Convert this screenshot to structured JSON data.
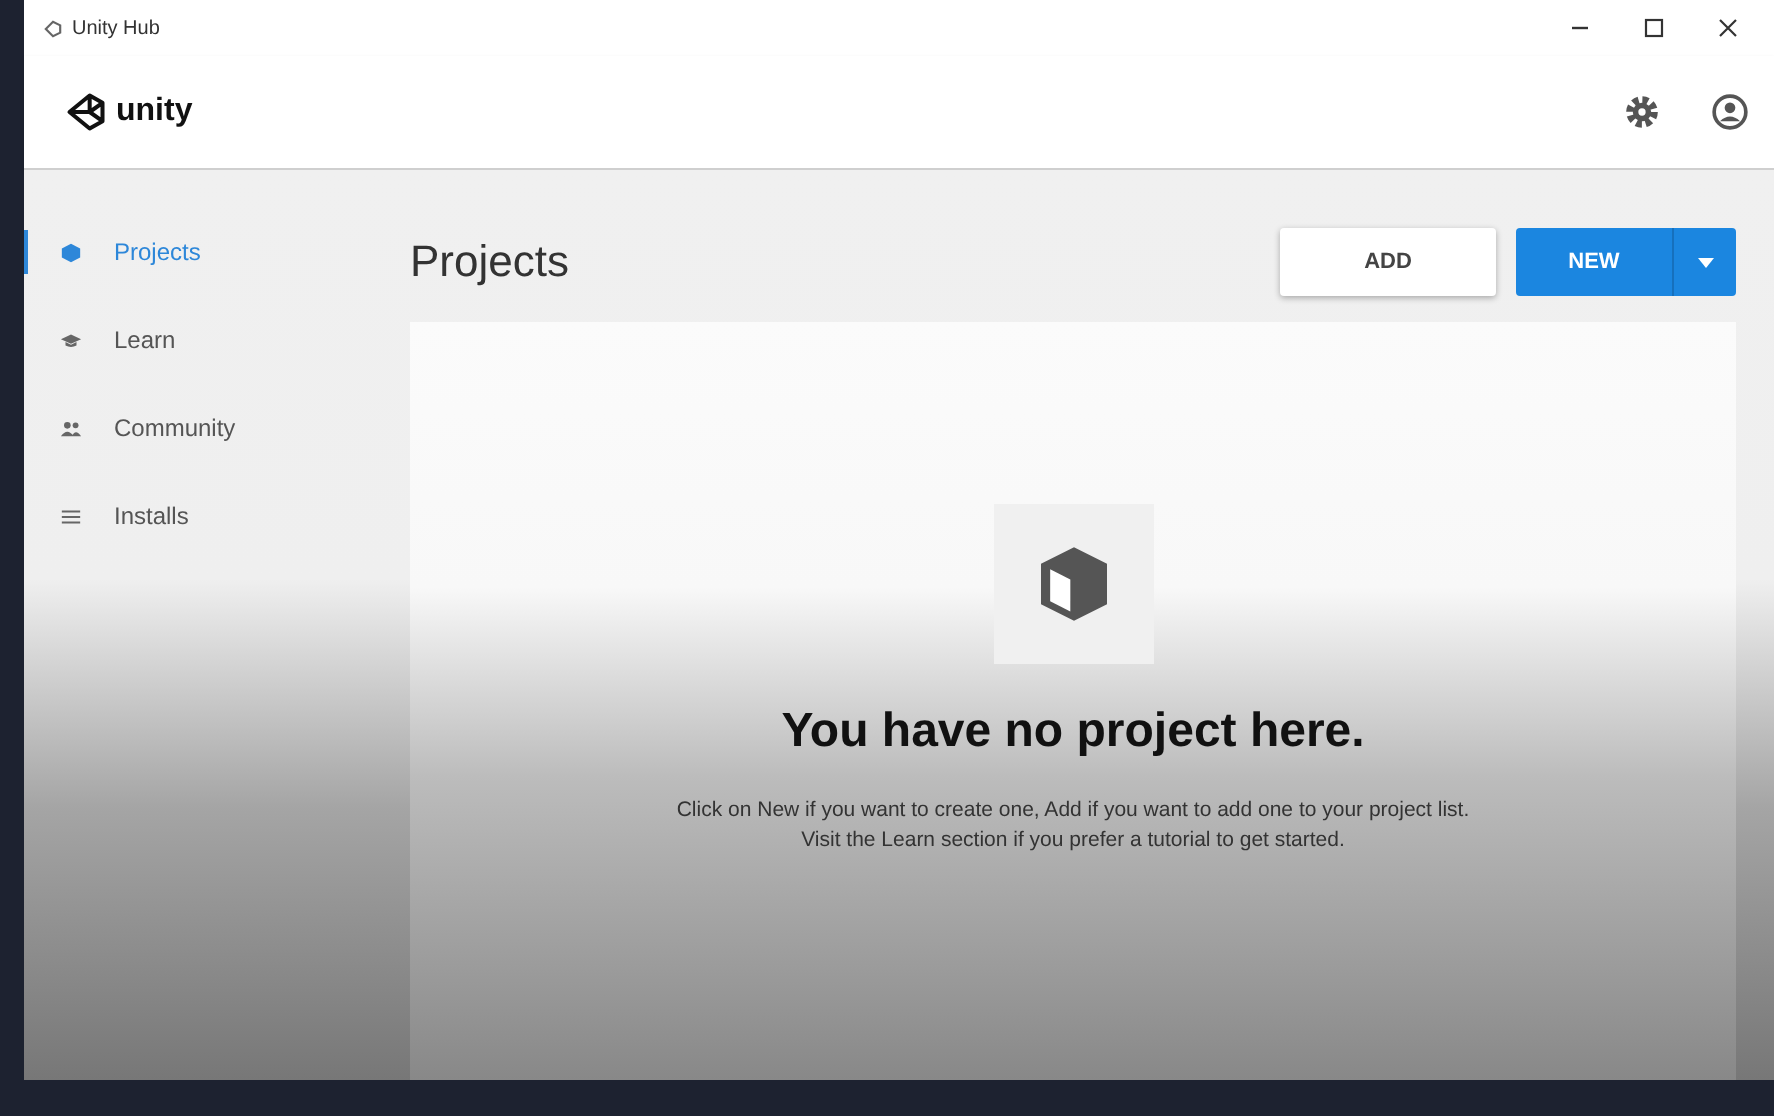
{
  "window": {
    "title": "Unity Hub"
  },
  "header": {
    "logo_text": "unity"
  },
  "sidebar": {
    "items": [
      {
        "label": "Projects",
        "kind": "projects",
        "selected": true
      },
      {
        "label": "Learn",
        "kind": "learn",
        "selected": false
      },
      {
        "label": "Community",
        "kind": "community",
        "selected": false
      },
      {
        "label": "Installs",
        "kind": "installs",
        "selected": false
      }
    ]
  },
  "page": {
    "title": "Projects",
    "add_button": "ADD",
    "new_button": "NEW",
    "empty_state": {
      "title": "You have no project here.",
      "message": "Click on New if you want to create one, Add if you want to add one to your project list. Visit the Learn section if you prefer a tutorial to get started."
    }
  }
}
